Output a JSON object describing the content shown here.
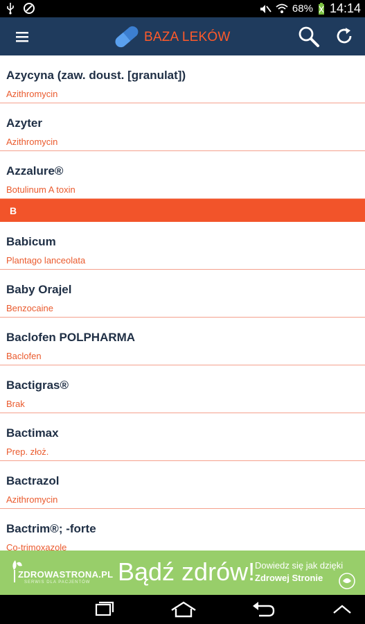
{
  "status": {
    "battery": "68%",
    "time": "14:14"
  },
  "app": {
    "title": "BAZA LEKÓW"
  },
  "list": {
    "items_a": [
      {
        "name": "Azycyna (zaw. doust. [granulat])",
        "sub": "Azithromycin"
      },
      {
        "name": "Azyter",
        "sub": "Azithromycin"
      },
      {
        "name": "Azzalure®",
        "sub": "Botulinum A toxin"
      }
    ],
    "section_letter": "B",
    "items_b": [
      {
        "name": "Babicum",
        "sub": "Plantago lanceolata"
      },
      {
        "name": "Baby Orajel",
        "sub": "Benzocaine"
      },
      {
        "name": "Baclofen POLPHARMA",
        "sub": "Baclofen"
      },
      {
        "name": "Bactigras®",
        "sub": "Brak"
      },
      {
        "name": "Bactimax",
        "sub": "Prep. złoż."
      },
      {
        "name": "Bactrazol",
        "sub": "Azithromycin"
      },
      {
        "name": "Bactrim®; -forte",
        "sub": "Co-trimoxazole"
      }
    ]
  },
  "ad": {
    "brand": "ZDROWASTRONA.PL",
    "tagline": "SERWIS DLA PACJENTÓW",
    "slogan": "Bądź zdrów!",
    "line1": "Dowiedz się jak dzięki",
    "line2": "Zdrowej Stronie"
  },
  "icons": {
    "menu": "hamburger-menu-icon",
    "search": "search-icon",
    "refresh": "refresh-icon",
    "back": "back-icon",
    "home": "home-icon",
    "recents": "recent-apps-icon"
  },
  "colors": {
    "appbar": "#1f3b5d",
    "accent": "#f2542a",
    "ad": "#98ce6a"
  }
}
